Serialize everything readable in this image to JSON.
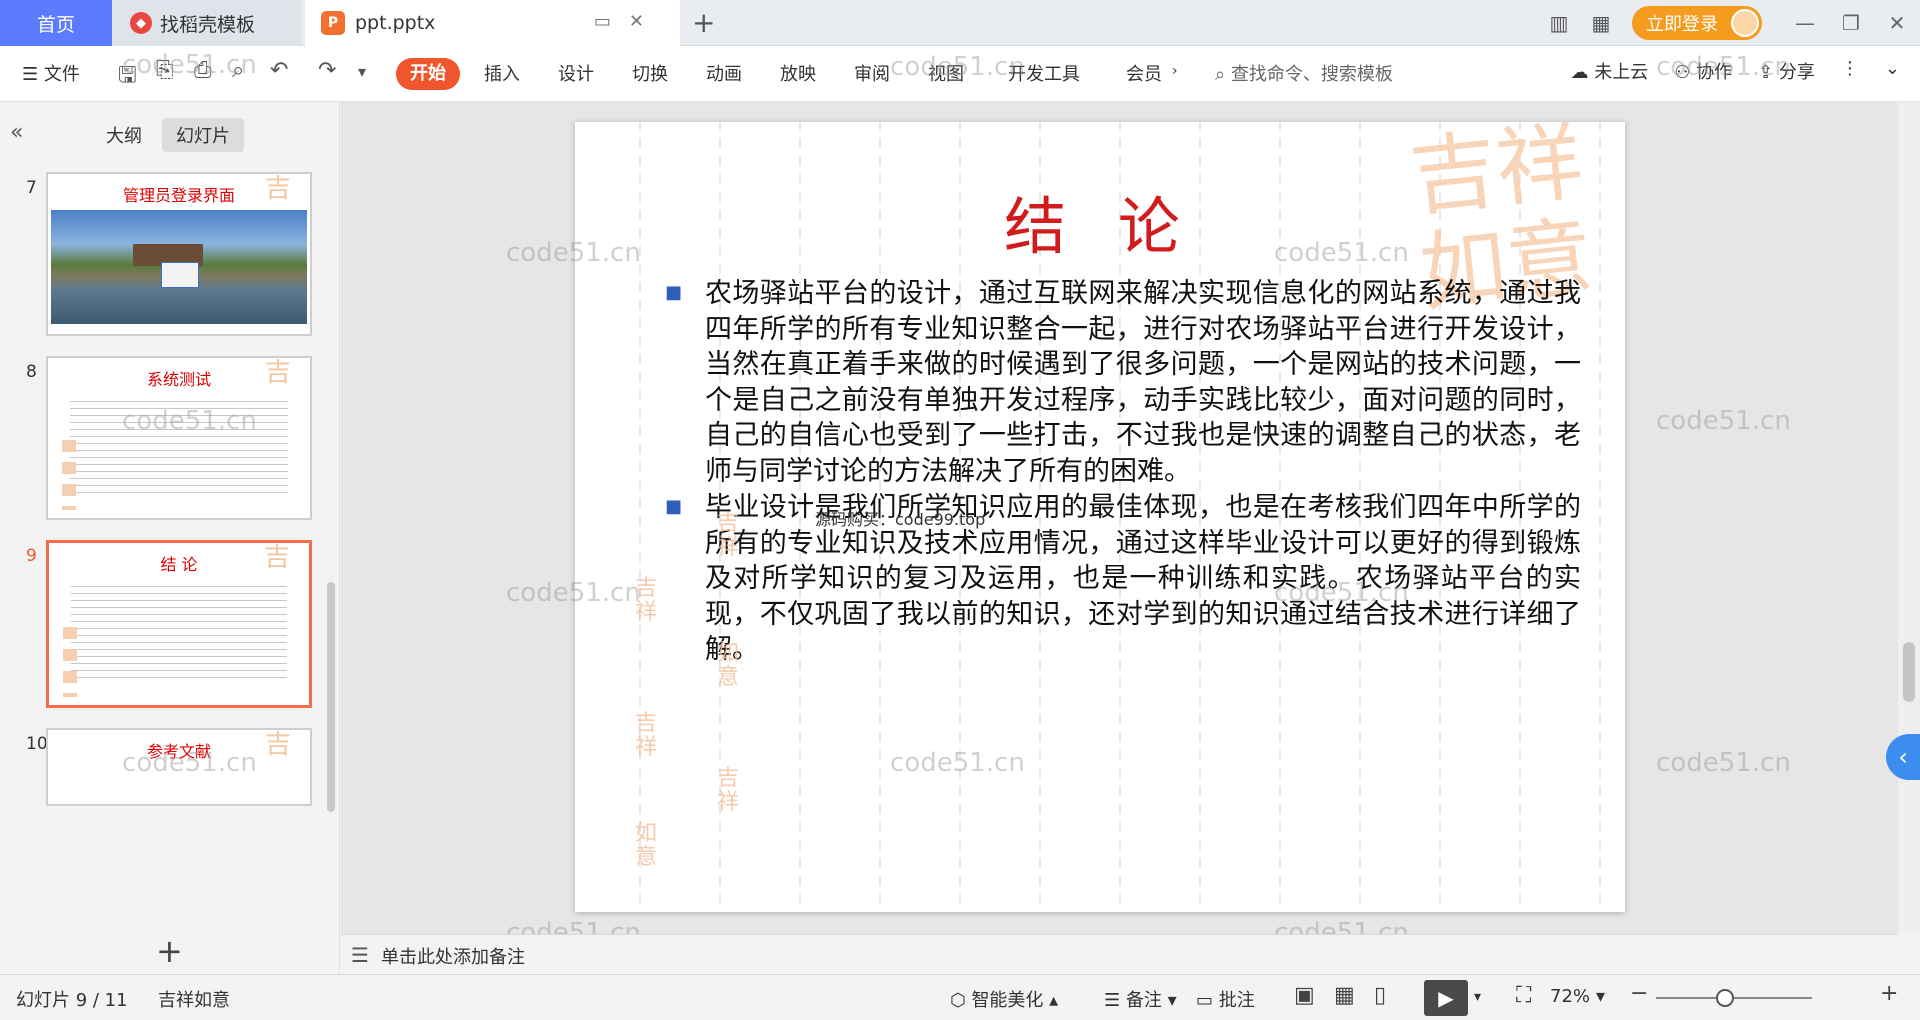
{
  "titlebar": {
    "tabs": [
      {
        "label": "首页"
      },
      {
        "label": "找稻壳模板"
      },
      {
        "label": "ppt.pptx"
      }
    ],
    "login_label": "立即登录"
  },
  "menubar": {
    "file_label": "文件",
    "tabs": [
      "开始",
      "插入",
      "设计",
      "切换",
      "动画",
      "放映",
      "审阅",
      "视图",
      "开发工具",
      "会员"
    ],
    "search_placeholder": "查找命令、搜索模板",
    "right_items": [
      "未上云",
      "协作",
      "分享"
    ]
  },
  "leftpanel": {
    "view_tabs": [
      "大纲",
      "幻灯片"
    ],
    "active_view": "幻灯片",
    "thumbnails": [
      {
        "num": "7",
        "title": "管理员登录界面"
      },
      {
        "num": "8",
        "title": "系统测试"
      },
      {
        "num": "9",
        "title": "结 论"
      },
      {
        "num": "10",
        "title": "参考文献"
      }
    ]
  },
  "slide": {
    "title": "结 论",
    "paragraphs": [
      "农场驿站平台的设计，通过互联网来解决实现信息化的网站系统，通过我四年所学的所有专业知识整合一起，进行对农场驿站平台进行开发设计，当然在真正着手来做的时候遇到了很多问题，一个是网站的技术问题，一个是自己之前没有单独开发过程序，动手实践比较少，面对问题的同时，自己的自信心也受到了一些打击，不过我也是快速的调整自己的状态，老师与同学讨论的方法解决了所有的困难。",
      "毕业设计是我们所学知识应用的最佳体现，也是在考核我们四年中所学的所有的专业知识及技术应用情况，通过这样毕业设计可以更好的得到锻炼及对所学知识的复习及运用，也是一种训练和实践。农场驿站平台的实现，不仅巩固了我以前的知识，还对学到的知识通过结合技术进行详细了解。"
    ],
    "overlay_text": "源码购买：code99.top",
    "stamp_text": "吉祥如意"
  },
  "watermark": "code51.cn",
  "notes_placeholder": "单击此处添加备注",
  "statusbar": {
    "slide_info": "幻灯片 9 / 11",
    "theme": "吉祥如意",
    "smart": "智能美化",
    "notes": "备注",
    "comment": "批注",
    "zoom": "72%"
  },
  "colors": {
    "accent_orange": "#f0562e",
    "title_red": "#d21c1c",
    "login_orange": "#f59b1d",
    "home_blue": "#5b7cff"
  }
}
